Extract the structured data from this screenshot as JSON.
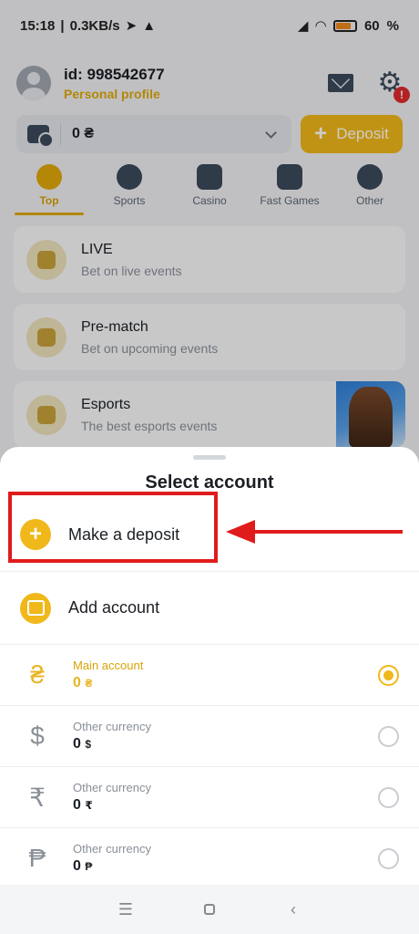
{
  "status": {
    "time": "15:18",
    "speed": "0.3KB/s",
    "battery": "60"
  },
  "profile": {
    "id": "id: 998542677",
    "link": "Personal profile"
  },
  "balance": {
    "value": "0 ₴",
    "deposit_label": "Deposit"
  },
  "categories": [
    {
      "label": "Top",
      "active": true
    },
    {
      "label": "Sports"
    },
    {
      "label": "Casino"
    },
    {
      "label": "Fast Games"
    },
    {
      "label": "Other"
    }
  ],
  "cards": [
    {
      "title": "LIVE",
      "subtitle": "Bet on live events"
    },
    {
      "title": "Pre-match",
      "subtitle": "Bet on upcoming events"
    },
    {
      "title": "Esports",
      "subtitle": "The best esports events"
    }
  ],
  "sheet": {
    "title": "Select account",
    "make_deposit": "Make a deposit",
    "add_account": "Add account",
    "accounts": [
      {
        "symbol": "₴",
        "name": "Main account",
        "value": "0",
        "currency": "₴",
        "selected": true
      },
      {
        "symbol": "$",
        "name": "Other currency",
        "value": "0",
        "currency": "$"
      },
      {
        "symbol": "₹",
        "name": "Other currency",
        "value": "0",
        "currency": "₹"
      },
      {
        "symbol": "₱",
        "name": "Other currency",
        "value": "0",
        "currency": "₱"
      }
    ]
  },
  "colors": {
    "accent": "#f0b81a",
    "highlight": "#e01b1b"
  }
}
